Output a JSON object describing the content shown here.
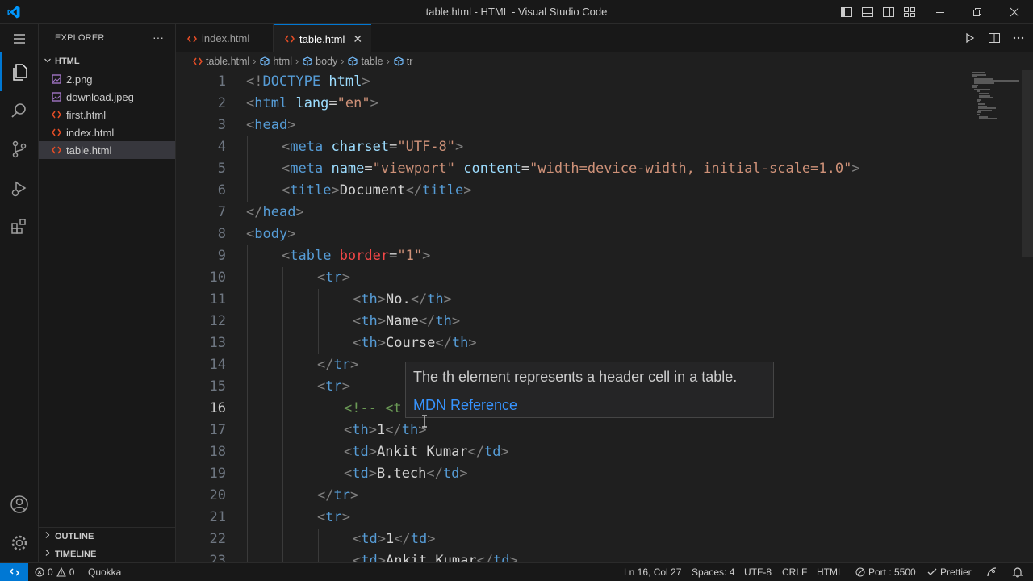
{
  "window": {
    "title": "table.html - HTML - Visual Studio Code"
  },
  "activity_bar": {
    "items": [
      "explorer-icon",
      "search-icon",
      "source-control-icon",
      "run-debug-icon",
      "extensions-icon"
    ],
    "bottom": [
      "account-icon",
      "manage-gear-icon"
    ]
  },
  "sidebar": {
    "header": "EXPLORER",
    "more": "···",
    "folder": "HTML",
    "files": [
      {
        "name": "2.png",
        "icon": "image-file-icon",
        "color": "#a074c4"
      },
      {
        "name": "download.jpeg",
        "icon": "image-file-icon",
        "color": "#a074c4"
      },
      {
        "name": "first.html",
        "icon": "html-file-icon",
        "color": "#e44d26"
      },
      {
        "name": "index.html",
        "icon": "html-file-icon",
        "color": "#e44d26"
      },
      {
        "name": "table.html",
        "icon": "html-file-icon",
        "color": "#e44d26"
      }
    ],
    "outline": "OUTLINE",
    "timeline": "TIMELINE"
  },
  "tabs": [
    {
      "label": "index.html",
      "active": false
    },
    {
      "label": "table.html",
      "active": true
    }
  ],
  "tab_close": "✕",
  "breadcrumb": [
    "table.html",
    "html",
    "body",
    "table",
    "tr"
  ],
  "breadcrumb_sep": "›",
  "editor": {
    "current_line": 16,
    "lines": [
      {
        "n": "1",
        "indent": 0,
        "tokens": [
          [
            "punc",
            "<!"
          ],
          [
            "kw",
            "DOCTYPE"
          ],
          [
            "txt",
            " "
          ],
          [
            "attr",
            "html"
          ],
          [
            "punc",
            ">"
          ]
        ]
      },
      {
        "n": "2",
        "indent": 0,
        "tokens": [
          [
            "punc",
            "<"
          ],
          [
            "tag",
            "html"
          ],
          [
            "txt",
            " "
          ],
          [
            "attr",
            "lang"
          ],
          [
            "txt",
            "="
          ],
          [
            "str",
            "\"en\""
          ],
          [
            "punc",
            ">"
          ]
        ]
      },
      {
        "n": "3",
        "indent": 0,
        "tokens": [
          [
            "punc",
            "<"
          ],
          [
            "tag",
            "head"
          ],
          [
            "punc",
            ">"
          ]
        ]
      },
      {
        "n": "4",
        "indent": 1,
        "tokens": [
          [
            "punc",
            "<"
          ],
          [
            "tag",
            "meta"
          ],
          [
            "txt",
            " "
          ],
          [
            "attr",
            "charset"
          ],
          [
            "txt",
            "="
          ],
          [
            "str",
            "\"UTF-8\""
          ],
          [
            "punc",
            ">"
          ]
        ]
      },
      {
        "n": "5",
        "indent": 1,
        "tokens": [
          [
            "punc",
            "<"
          ],
          [
            "tag",
            "meta"
          ],
          [
            "txt",
            " "
          ],
          [
            "attr",
            "name"
          ],
          [
            "txt",
            "="
          ],
          [
            "str",
            "\"viewport\""
          ],
          [
            "txt",
            " "
          ],
          [
            "attr",
            "content"
          ],
          [
            "txt",
            "="
          ],
          [
            "str",
            "\"width=device-width, initial-scale=1.0\""
          ],
          [
            "punc",
            ">"
          ]
        ]
      },
      {
        "n": "6",
        "indent": 1,
        "tokens": [
          [
            "punc",
            "<"
          ],
          [
            "tag",
            "title"
          ],
          [
            "punc",
            ">"
          ],
          [
            "txt",
            "Document"
          ],
          [
            "punc",
            "</"
          ],
          [
            "tag",
            "title"
          ],
          [
            "punc",
            ">"
          ]
        ]
      },
      {
        "n": "7",
        "indent": 0,
        "tokens": [
          [
            "punc",
            "</"
          ],
          [
            "tag",
            "head"
          ],
          [
            "punc",
            ">"
          ]
        ]
      },
      {
        "n": "8",
        "indent": 0,
        "tokens": [
          [
            "punc",
            "<"
          ],
          [
            "tag",
            "body"
          ],
          [
            "punc",
            ">"
          ]
        ]
      },
      {
        "n": "9",
        "indent": 1,
        "tokens": [
          [
            "punc",
            "<"
          ],
          [
            "tag",
            "table"
          ],
          [
            "txt",
            " "
          ],
          [
            "attrred",
            "border"
          ],
          [
            "txt",
            "="
          ],
          [
            "str",
            "\"1\""
          ],
          [
            "punc",
            ">"
          ]
        ]
      },
      {
        "n": "10",
        "indent": 2,
        "tokens": [
          [
            "punc",
            "<"
          ],
          [
            "tag",
            "tr"
          ],
          [
            "punc",
            ">"
          ]
        ]
      },
      {
        "n": "11",
        "indent": 3,
        "tokens": [
          [
            "punc",
            "<"
          ],
          [
            "tag",
            "th"
          ],
          [
            "punc",
            ">"
          ],
          [
            "txt",
            "No."
          ],
          [
            "punc",
            "</"
          ],
          [
            "tag",
            "th"
          ],
          [
            "punc",
            ">"
          ]
        ]
      },
      {
        "n": "12",
        "indent": 3,
        "tokens": [
          [
            "punc",
            "<"
          ],
          [
            "tag",
            "th"
          ],
          [
            "punc",
            ">"
          ],
          [
            "txt",
            "Name"
          ],
          [
            "punc",
            "</"
          ],
          [
            "tag",
            "th"
          ],
          [
            "punc",
            ">"
          ]
        ]
      },
      {
        "n": "13",
        "indent": 3,
        "tokens": [
          [
            "punc",
            "<"
          ],
          [
            "tag",
            "th"
          ],
          [
            "punc",
            ">"
          ],
          [
            "txt",
            "Course"
          ],
          [
            "punc",
            "</"
          ],
          [
            "tag",
            "th"
          ],
          [
            "punc",
            ">"
          ]
        ]
      },
      {
        "n": "14",
        "indent": 2,
        "tokens": [
          [
            "punc",
            "</"
          ],
          [
            "tag",
            "tr"
          ],
          [
            "punc",
            ">"
          ]
        ]
      },
      {
        "n": "15",
        "indent": 2,
        "tokens": [
          [
            "punc",
            "<"
          ],
          [
            "tag",
            "tr"
          ],
          [
            "punc",
            ">"
          ]
        ]
      },
      {
        "n": "16",
        "indent": 2.75,
        "tokens": [
          [
            "com",
            "<!-- <t"
          ]
        ]
      },
      {
        "n": "17",
        "indent": 2.75,
        "tokens": [
          [
            "punc",
            "<"
          ],
          [
            "tag",
            "th"
          ],
          [
            "punc",
            ">"
          ],
          [
            "txt",
            "1"
          ],
          [
            "punc",
            "</"
          ],
          [
            "tag",
            "th"
          ],
          [
            "punc",
            ">"
          ]
        ]
      },
      {
        "n": "18",
        "indent": 2.75,
        "tokens": [
          [
            "punc",
            "<"
          ],
          [
            "tag",
            "td"
          ],
          [
            "punc",
            ">"
          ],
          [
            "txt",
            "Ankit Kumar"
          ],
          [
            "punc",
            "</"
          ],
          [
            "tag",
            "td"
          ],
          [
            "punc",
            ">"
          ]
        ]
      },
      {
        "n": "19",
        "indent": 2.75,
        "tokens": [
          [
            "punc",
            "<"
          ],
          [
            "tag",
            "td"
          ],
          [
            "punc",
            ">"
          ],
          [
            "txt",
            "B.tech"
          ],
          [
            "punc",
            "</"
          ],
          [
            "tag",
            "td"
          ],
          [
            "punc",
            ">"
          ]
        ]
      },
      {
        "n": "20",
        "indent": 2,
        "tokens": [
          [
            "punc",
            "</"
          ],
          [
            "tag",
            "tr"
          ],
          [
            "punc",
            ">"
          ]
        ]
      },
      {
        "n": "21",
        "indent": 2,
        "tokens": [
          [
            "punc",
            "<"
          ],
          [
            "tag",
            "tr"
          ],
          [
            "punc",
            ">"
          ]
        ]
      },
      {
        "n": "22",
        "indent": 3,
        "tokens": [
          [
            "punc",
            "<"
          ],
          [
            "tag",
            "td"
          ],
          [
            "punc",
            ">"
          ],
          [
            "txt",
            "1"
          ],
          [
            "punc",
            "</"
          ],
          [
            "tag",
            "td"
          ],
          [
            "punc",
            ">"
          ]
        ]
      },
      {
        "n": "23",
        "indent": 3,
        "tokens": [
          [
            "punc",
            "<"
          ],
          [
            "tag",
            "td"
          ],
          [
            "punc",
            ">"
          ],
          [
            "txt",
            "Ankit Kumar"
          ],
          [
            "punc",
            "</"
          ],
          [
            "tag",
            "td"
          ],
          [
            "punc",
            ">"
          ]
        ]
      }
    ]
  },
  "hover": {
    "description": "The th element represents a header cell in a table.",
    "link": "MDN Reference"
  },
  "statusbar": {
    "errors": "0",
    "warnings": "0",
    "quokka": "Quokka",
    "position": "Ln 16, Col 27",
    "spaces": "Spaces: 4",
    "encoding": "UTF-8",
    "eol": "CRLF",
    "language": "HTML",
    "port": "Port : 5500",
    "prettier": "Prettier"
  },
  "colors": {
    "accent": "#0078d4",
    "link": "#3794ff"
  }
}
